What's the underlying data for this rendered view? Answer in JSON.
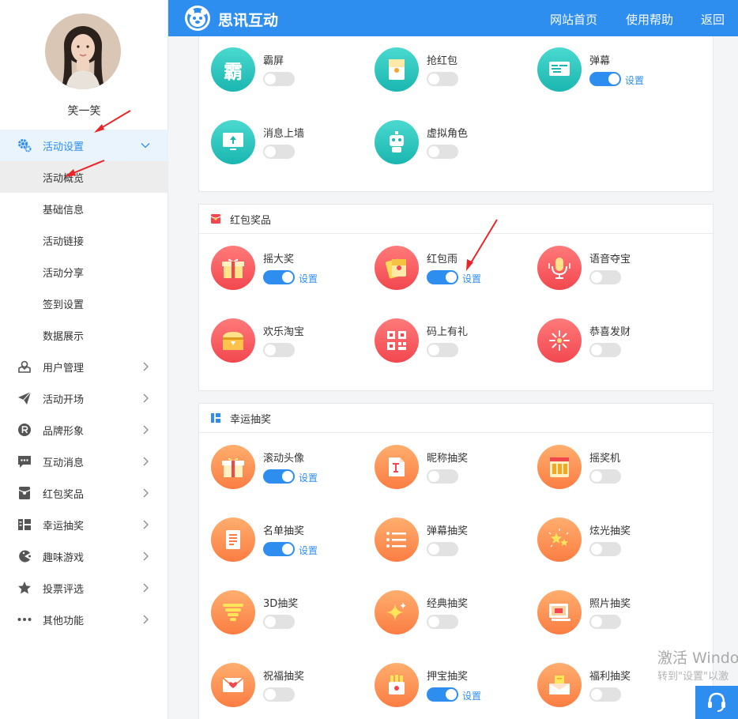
{
  "user": {
    "name": "笑一笑"
  },
  "header": {
    "brand": "思讯互动",
    "nav": [
      "网站首页",
      "使用帮助",
      "返回"
    ]
  },
  "sidebar": {
    "active_menu": "活动设置",
    "submenu": [
      "活动概览",
      "基础信息",
      "活动链接",
      "活动分享",
      "签到设置",
      "数据展示"
    ],
    "menu": [
      "用户管理",
      "活动开场",
      "品牌形象",
      "互动消息",
      "红包奖品",
      "幸运抽奖",
      "趣味游戏",
      "投票评选",
      "其他功能"
    ]
  },
  "setting_label": "设置",
  "sections": [
    {
      "title": "",
      "features": [
        {
          "name": "霸屏",
          "on": false
        },
        {
          "name": "抢红包",
          "on": false
        },
        {
          "name": "弹幕",
          "on": true
        },
        {
          "name": "消息上墙",
          "on": false
        },
        {
          "name": "虚拟角色",
          "on": false
        }
      ]
    },
    {
      "title": "红包奖品",
      "features": [
        {
          "name": "摇大奖",
          "on": true
        },
        {
          "name": "红包雨",
          "on": true
        },
        {
          "name": "语音夺宝",
          "on": false
        },
        {
          "name": "欢乐淘宝",
          "on": false
        },
        {
          "name": "码上有礼",
          "on": false
        },
        {
          "name": "恭喜发财",
          "on": false
        }
      ]
    },
    {
      "title": "幸运抽奖",
      "features": [
        {
          "name": "滚动头像",
          "on": true
        },
        {
          "name": "昵称抽奖",
          "on": false
        },
        {
          "name": "摇奖机",
          "on": false
        },
        {
          "name": "名单抽奖",
          "on": true
        },
        {
          "name": "弹幕抽奖",
          "on": false
        },
        {
          "name": "炫光抽奖",
          "on": false
        },
        {
          "name": "3D抽奖",
          "on": false
        },
        {
          "name": "经典抽奖",
          "on": false
        },
        {
          "name": "照片抽奖",
          "on": false
        },
        {
          "name": "祝福抽奖",
          "on": false
        },
        {
          "name": "押宝抽奖",
          "on": true
        },
        {
          "name": "福利抽奖",
          "on": false
        }
      ]
    }
  ],
  "watermark": {
    "line1": "激活 Windo",
    "line2": "转到\"设置\"以激"
  },
  "colors": {
    "primary": "#2e8ef0",
    "teal": "#1ab6b0",
    "red": "#f2474f",
    "orange": "#fb7d43"
  }
}
